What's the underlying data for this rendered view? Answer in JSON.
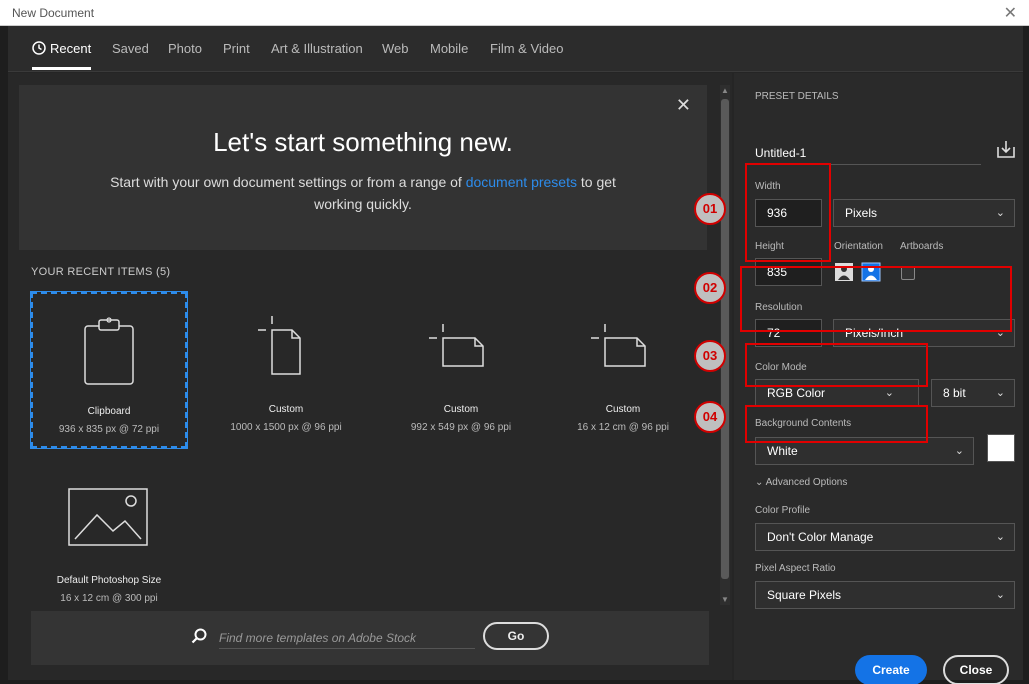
{
  "window": {
    "title": "New Document",
    "close_glyph": "✕"
  },
  "tabs": [
    {
      "label": "Recent",
      "active": true,
      "icon": "clock-icon"
    },
    {
      "label": "Saved"
    },
    {
      "label": "Photo"
    },
    {
      "label": "Print"
    },
    {
      "label": "Art & Illustration"
    },
    {
      "label": "Web"
    },
    {
      "label": "Mobile"
    },
    {
      "label": "Film & Video"
    }
  ],
  "hero": {
    "title": "Let's start something new.",
    "subtitle_before": "Start with your own document settings or from a range of ",
    "subtitle_link": "document presets",
    "subtitle_after": " to get working quickly.",
    "close_glyph": "✕"
  },
  "recent": {
    "heading": "YOUR RECENT ITEMS",
    "count": "(5)",
    "items": [
      {
        "name": "Clipboard",
        "desc": "936 x 835 px @ 72 ppi",
        "icon": "clipboard-icon",
        "selected": true
      },
      {
        "name": "Custom",
        "desc": "1000 x 1500 px @ 96 ppi",
        "icon": "portrait-document-icon"
      },
      {
        "name": "Custom",
        "desc": "992 x 549 px @ 96 ppi",
        "icon": "landscape-document-icon"
      },
      {
        "name": "Custom",
        "desc": "16 x 12 cm @ 96 ppi",
        "icon": "landscape-document-icon"
      },
      {
        "name": "Default Photoshop Size",
        "desc": "16 x 12 cm @ 300 ppi",
        "icon": "image-icon"
      }
    ]
  },
  "search": {
    "placeholder": "Find more templates on Adobe Stock",
    "go_label": "Go"
  },
  "preset": {
    "section_label": "PRESET DETAILS",
    "doc_name": "Untitled-1",
    "width_label": "Width",
    "width_value": "936",
    "width_unit": "Pixels",
    "height_label": "Height",
    "height_value": "835",
    "orientation_label": "Orientation",
    "artboards_label": "Artboards",
    "resolution_label": "Resolution",
    "resolution_value": "72",
    "resolution_unit": "Pixels/Inch",
    "color_mode_label": "Color Mode",
    "color_mode_value": "RGB Color",
    "bit_depth": "8 bit",
    "bg_label": "Background Contents",
    "bg_value": "White",
    "bg_color": "#ffffff",
    "advanced_label": "Advanced Options",
    "profile_label": "Color Profile",
    "profile_value": "Don't Color Manage",
    "aspect_label": "Pixel Aspect Ratio",
    "aspect_value": "Square Pixels",
    "create_label": "Create",
    "close_label": "Close"
  },
  "annotations": [
    "01",
    "02",
    "03",
    "04"
  ],
  "colors": {
    "accent": "#1473e6",
    "link": "#2d8ceb",
    "callout": "#e10000"
  }
}
